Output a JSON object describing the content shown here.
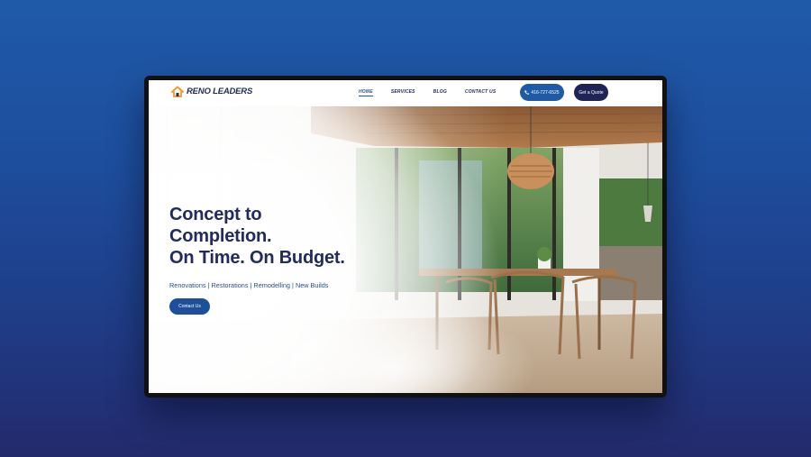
{
  "header": {
    "logo_text": "RENO LEADERS",
    "nav": [
      {
        "label": "HOME",
        "active": true
      },
      {
        "label": "SERVICES",
        "active": false
      },
      {
        "label": "BLOG",
        "active": false
      },
      {
        "label": "CONTACT US",
        "active": false
      }
    ],
    "phone_label": "416-727-6525",
    "quote_label": "Get a Quote"
  },
  "hero": {
    "headline_lines": [
      "Concept to",
      "Completion.",
      "On Time. On Budget."
    ],
    "services_line": "Renovations | Restorations | Remodelling | New Builds",
    "contact_label": "Contact Us"
  },
  "colors": {
    "background_top": "#1f5aa8",
    "background_bottom": "#232a6c",
    "brand_navy": "#222a5e",
    "brand_blue": "#1e5aa6",
    "logo_orange": "#f29a1f"
  },
  "icons": {
    "logo": "house-logo-icon",
    "phone": "phone-icon"
  }
}
